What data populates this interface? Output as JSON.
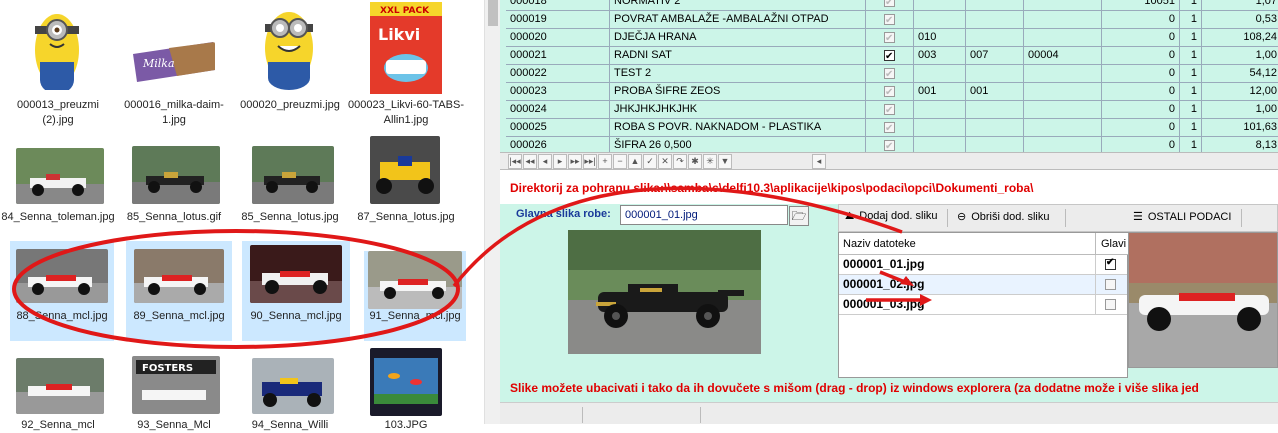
{
  "explorer": {
    "items": [
      {
        "label": "000013_preuzmi (2).jpg",
        "selected": false
      },
      {
        "label": "000016_milka-daim-1.jpg",
        "selected": false
      },
      {
        "label": "000020_preuzmi.jpg",
        "selected": false
      },
      {
        "label": "000023_Likvi-60-TABS-Allin1.jpg",
        "selected": false
      },
      {
        "label": "84_Senna_toleman.jpg",
        "selected": false
      },
      {
        "label": "85_Senna_lotus.gif",
        "selected": false
      },
      {
        "label": "85_Senna_lotus.jpg",
        "selected": false
      },
      {
        "label": "87_Senna_lotus.jpg",
        "selected": false
      },
      {
        "label": "88_Senna_mcl.jpg",
        "selected": true
      },
      {
        "label": "89_Senna_mcl.jpg",
        "selected": true
      },
      {
        "label": "90_Senna_mcl.jpg",
        "selected": true
      },
      {
        "label": "91_Senna_mcl.jpg",
        "selected": true
      }
    ],
    "partial_labels": [
      "92_Senna_mcl",
      "93_Senna_Mcl",
      "94_Senna_Willi",
      "103.JPG"
    ],
    "xxl_pack_text": "XXL PACK",
    "likvi_text": "Likvi"
  },
  "grid": {
    "rows": [
      {
        "code": "000018",
        "name": "NORMATIV 2",
        "checked": false,
        "c1": "",
        "c2": "",
        "c3": "",
        "n1": "10051",
        "n2": "1",
        "price": "1,07"
      },
      {
        "code": "000019",
        "name": "POVRAT AMBALAŽE -AMBALAŽNI OTPAD",
        "checked": false,
        "c1": "",
        "c2": "",
        "c3": "",
        "n1": "0",
        "n2": "1",
        "price": "0,53"
      },
      {
        "code": "000020",
        "name": "DJEČJA HRANA",
        "checked": false,
        "c1": "010",
        "c2": "",
        "c3": "",
        "n1": "0",
        "n2": "1",
        "price": "108,24"
      },
      {
        "code": "000021",
        "name": "RADNI SAT",
        "checked": true,
        "c1": "003",
        "c2": "007",
        "c3": "00004",
        "n1": "0",
        "n2": "1",
        "price": "1,00"
      },
      {
        "code": "000022",
        "name": "TEST 2",
        "checked": false,
        "c1": "",
        "c2": "",
        "c3": "",
        "n1": "0",
        "n2": "1",
        "price": "54,12"
      },
      {
        "code": "000023",
        "name": "PROBA ŠIFRE ZEOS",
        "checked": false,
        "c1": "001",
        "c2": "001",
        "c3": "",
        "n1": "0",
        "n2": "1",
        "price": "12,00"
      },
      {
        "code": "000024",
        "name": "JHKJHKJHKJHK",
        "checked": false,
        "c1": "",
        "c2": "",
        "c3": "",
        "n1": "0",
        "n2": "1",
        "price": "1,00"
      },
      {
        "code": "000025",
        "name": "ROBA S POVR. NAKNADOM - PLASTIKA",
        "checked": false,
        "c1": "",
        "c2": "",
        "c3": "",
        "n1": "0",
        "n2": "1",
        "price": "101,63"
      },
      {
        "code": "000026",
        "name": "ŠIFRA 26 0,500",
        "checked": false,
        "c1": "",
        "c2": "",
        "c3": "",
        "n1": "0",
        "n2": "1",
        "price": "8,13"
      }
    ]
  },
  "navigator": [
    "|◂◂",
    "◂◂",
    "◂",
    "▸",
    "▸▸",
    "▸▸|",
    "+",
    "−",
    "▲",
    "✓",
    "✕",
    "↷",
    "✱",
    "✳",
    "▼"
  ],
  "directory_text": "Direktorij za pohranu slika:\\\\samba\\c\\delfi10.3\\aplikacije\\kipos\\podaci\\opci\\Dokumenti_roba\\",
  "main_image": {
    "label": "Glavna slika robe:",
    "value": "000001_01.jpg"
  },
  "toolbar": {
    "add_label": "Dodaj dod. sliku",
    "remove_label": "Obriši dod. sliku",
    "other_label": "OSTALI PODACI"
  },
  "files": {
    "header_name": "Naziv datoteke",
    "header_main": "Glavi",
    "rows": [
      {
        "name": "000001_01.jpg",
        "main": true
      },
      {
        "name": "000001_02.jpg",
        "main": false
      },
      {
        "name": "000001_03.jpg",
        "main": false
      }
    ]
  },
  "hint_text": "Slike možete ubacivati i tako da ih dovučete s mišom (drag - drop) iz windows explorera (za dodatne može i više slika jed",
  "colors": {
    "accent_red": "#e00000",
    "grid_bg": "#ccf5e8",
    "selection": "#cce8ff",
    "label_blue": "#1a3a9a"
  }
}
